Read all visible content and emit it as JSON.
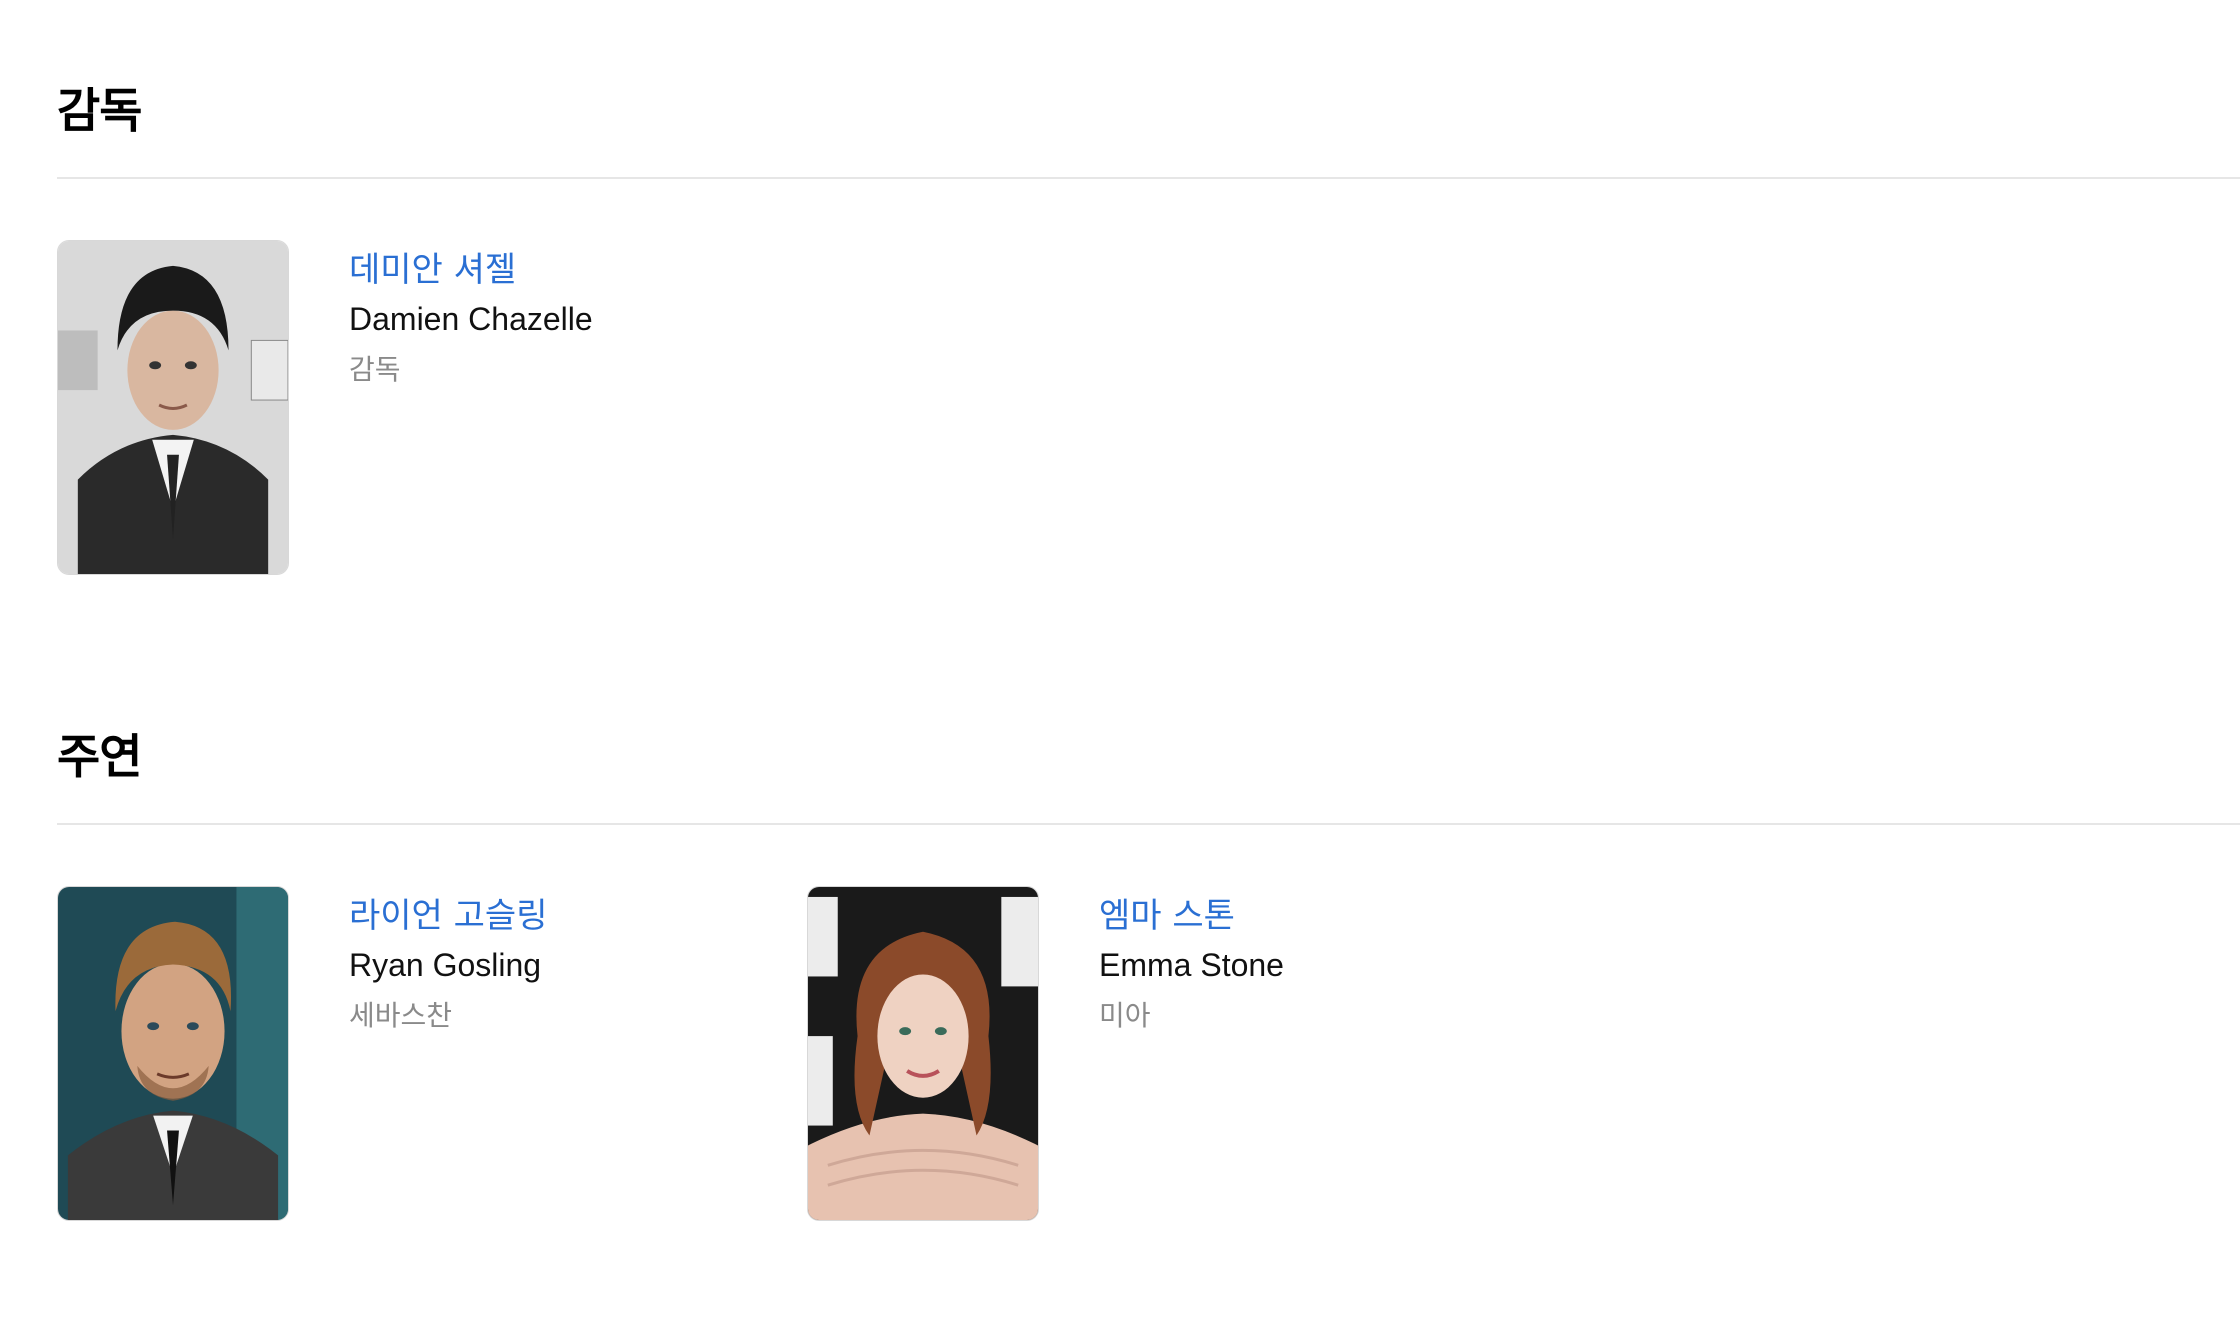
{
  "sections": [
    {
      "title": "감독",
      "people": [
        {
          "name_ko": "데미안 셔젤",
          "name_en": "Damien Chazelle",
          "role": "감독",
          "photo": "director-portrait"
        }
      ]
    },
    {
      "title": "주연",
      "people": [
        {
          "name_ko": "라이언 고슬링",
          "name_en": "Ryan Gosling",
          "role": "세바스찬",
          "photo": "actor-portrait"
        },
        {
          "name_ko": "엠마 스톤",
          "name_en": "Emma Stone",
          "role": "미아",
          "photo": "actress-portrait"
        }
      ]
    }
  ],
  "colors": {
    "link": "#2a6fd3",
    "role_text": "#8a8a8a",
    "divider": "#e6e6e6"
  }
}
